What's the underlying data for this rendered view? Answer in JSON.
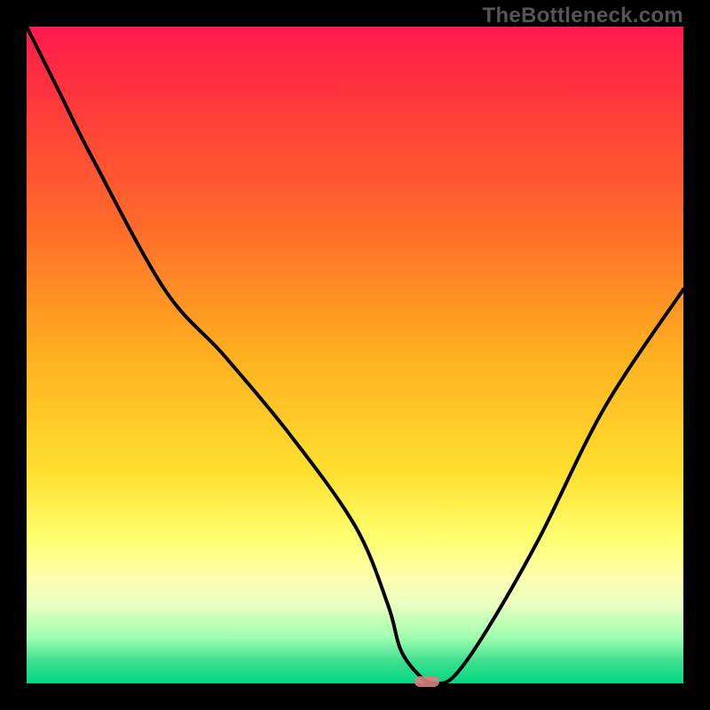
{
  "watermark": "TheBottleneck.com",
  "chart_data": {
    "type": "line",
    "title": "",
    "xlabel": "",
    "ylabel": "",
    "x": [
      0,
      5,
      10,
      21,
      30,
      40,
      50,
      55,
      57,
      60,
      62,
      65,
      70,
      78,
      88,
      100
    ],
    "values": [
      100,
      90,
      80,
      60,
      50,
      38,
      24,
      12,
      5,
      1,
      0,
      1,
      8,
      22,
      42,
      60
    ],
    "ylim": [
      0,
      100
    ],
    "xlim": [
      0,
      100
    ],
    "marker": {
      "x": 61,
      "y": 0
    }
  },
  "colors": {
    "background": "#000000",
    "line": "#000000",
    "marker": "#d98080"
  }
}
